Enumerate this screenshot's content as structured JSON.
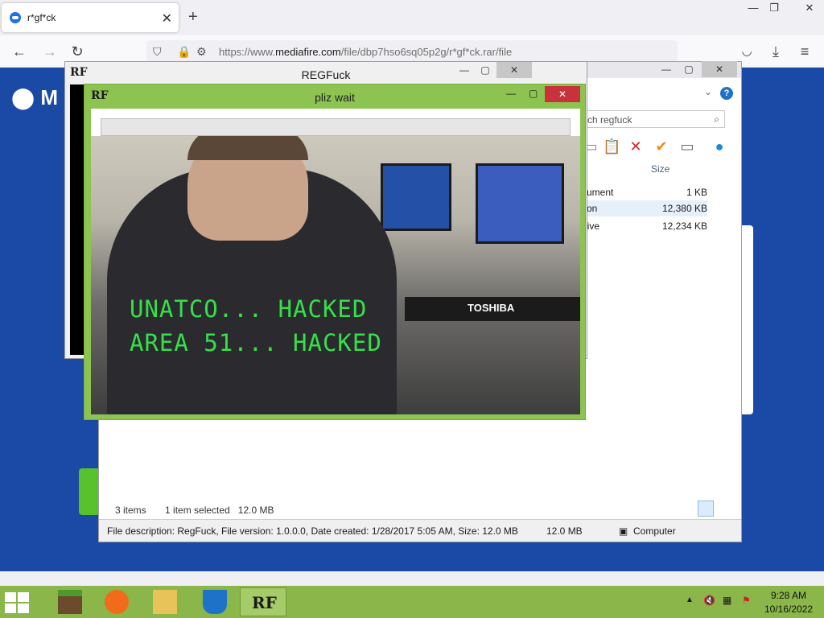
{
  "browser": {
    "tab_title": "r*gf*ck",
    "url_prefix": "https://www.",
    "url_domain": "mediafire.com",
    "url_path": "/file/dbp7hso6sq05p2g/r*gf*ck.rar/file"
  },
  "mediafire": {
    "logo": "M"
  },
  "explorer": {
    "search_placeholder": "rch regfuck",
    "column_size": "Size",
    "rows": [
      {
        "type": "cument",
        "size": "1 KB"
      },
      {
        "type": "tion",
        "size": "12,380 KB"
      },
      {
        "type": "hive",
        "size": "12,234 KB"
      }
    ],
    "status_items": "3 items",
    "status_selected": "1 item selected",
    "status_size": "12.0 MB",
    "file_description": "File description: RegFuck, File version: 1.0.0.0, Date created: 1/28/2017 5:05 AM, Size: 12.0 MB",
    "bottom_size": "12.0 MB",
    "bottom_location": "Computer"
  },
  "regfuck": {
    "title": "REGFuck",
    "icon_text": "RF"
  },
  "pliz": {
    "title": "pliz wait",
    "icon_text": "RF",
    "line1": "UNATCO... HACKED",
    "line2": "AREA 51... HACKED",
    "brand": "TOSHIBA"
  },
  "taskbar": {
    "time": "9:28 AM",
    "date": "10/16/2022"
  },
  "colors": {
    "taskbar": "#8ab64a",
    "window_accent": "#8dc451",
    "hacked_text": "#36e04a",
    "page_bg": "#1b4aa6"
  }
}
